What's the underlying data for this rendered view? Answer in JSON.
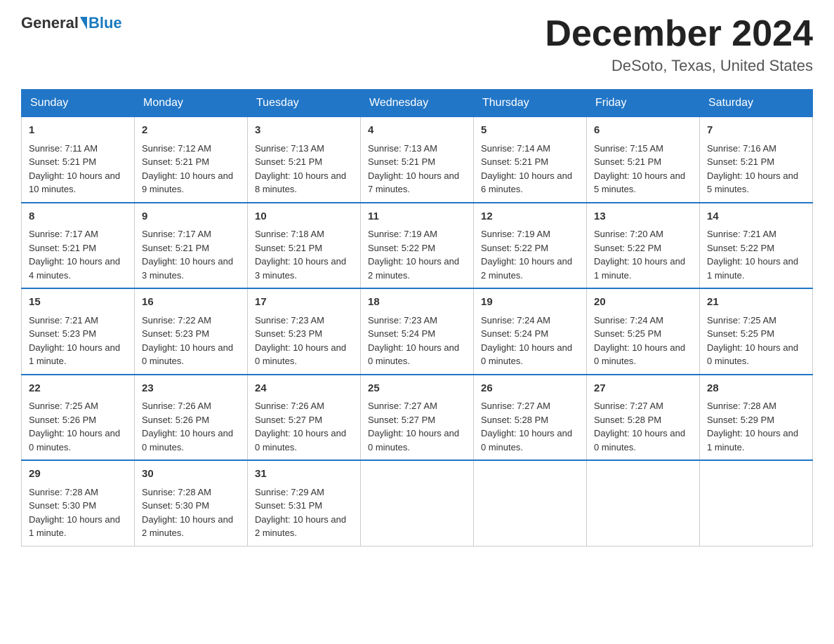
{
  "header": {
    "logo_general": "General",
    "logo_blue": "Blue",
    "month_title": "December 2024",
    "location": "DeSoto, Texas, United States"
  },
  "days_of_week": [
    "Sunday",
    "Monday",
    "Tuesday",
    "Wednesday",
    "Thursday",
    "Friday",
    "Saturday"
  ],
  "weeks": [
    [
      {
        "day": "1",
        "sunrise": "7:11 AM",
        "sunset": "5:21 PM",
        "daylight": "10 hours and 10 minutes."
      },
      {
        "day": "2",
        "sunrise": "7:12 AM",
        "sunset": "5:21 PM",
        "daylight": "10 hours and 9 minutes."
      },
      {
        "day": "3",
        "sunrise": "7:13 AM",
        "sunset": "5:21 PM",
        "daylight": "10 hours and 8 minutes."
      },
      {
        "day": "4",
        "sunrise": "7:13 AM",
        "sunset": "5:21 PM",
        "daylight": "10 hours and 7 minutes."
      },
      {
        "day": "5",
        "sunrise": "7:14 AM",
        "sunset": "5:21 PM",
        "daylight": "10 hours and 6 minutes."
      },
      {
        "day": "6",
        "sunrise": "7:15 AM",
        "sunset": "5:21 PM",
        "daylight": "10 hours and 5 minutes."
      },
      {
        "day": "7",
        "sunrise": "7:16 AM",
        "sunset": "5:21 PM",
        "daylight": "10 hours and 5 minutes."
      }
    ],
    [
      {
        "day": "8",
        "sunrise": "7:17 AM",
        "sunset": "5:21 PM",
        "daylight": "10 hours and 4 minutes."
      },
      {
        "day": "9",
        "sunrise": "7:17 AM",
        "sunset": "5:21 PM",
        "daylight": "10 hours and 3 minutes."
      },
      {
        "day": "10",
        "sunrise": "7:18 AM",
        "sunset": "5:21 PM",
        "daylight": "10 hours and 3 minutes."
      },
      {
        "day": "11",
        "sunrise": "7:19 AM",
        "sunset": "5:22 PM",
        "daylight": "10 hours and 2 minutes."
      },
      {
        "day": "12",
        "sunrise": "7:19 AM",
        "sunset": "5:22 PM",
        "daylight": "10 hours and 2 minutes."
      },
      {
        "day": "13",
        "sunrise": "7:20 AM",
        "sunset": "5:22 PM",
        "daylight": "10 hours and 1 minute."
      },
      {
        "day": "14",
        "sunrise": "7:21 AM",
        "sunset": "5:22 PM",
        "daylight": "10 hours and 1 minute."
      }
    ],
    [
      {
        "day": "15",
        "sunrise": "7:21 AM",
        "sunset": "5:23 PM",
        "daylight": "10 hours and 1 minute."
      },
      {
        "day": "16",
        "sunrise": "7:22 AM",
        "sunset": "5:23 PM",
        "daylight": "10 hours and 0 minutes."
      },
      {
        "day": "17",
        "sunrise": "7:23 AM",
        "sunset": "5:23 PM",
        "daylight": "10 hours and 0 minutes."
      },
      {
        "day": "18",
        "sunrise": "7:23 AM",
        "sunset": "5:24 PM",
        "daylight": "10 hours and 0 minutes."
      },
      {
        "day": "19",
        "sunrise": "7:24 AM",
        "sunset": "5:24 PM",
        "daylight": "10 hours and 0 minutes."
      },
      {
        "day": "20",
        "sunrise": "7:24 AM",
        "sunset": "5:25 PM",
        "daylight": "10 hours and 0 minutes."
      },
      {
        "day": "21",
        "sunrise": "7:25 AM",
        "sunset": "5:25 PM",
        "daylight": "10 hours and 0 minutes."
      }
    ],
    [
      {
        "day": "22",
        "sunrise": "7:25 AM",
        "sunset": "5:26 PM",
        "daylight": "10 hours and 0 minutes."
      },
      {
        "day": "23",
        "sunrise": "7:26 AM",
        "sunset": "5:26 PM",
        "daylight": "10 hours and 0 minutes."
      },
      {
        "day": "24",
        "sunrise": "7:26 AM",
        "sunset": "5:27 PM",
        "daylight": "10 hours and 0 minutes."
      },
      {
        "day": "25",
        "sunrise": "7:27 AM",
        "sunset": "5:27 PM",
        "daylight": "10 hours and 0 minutes."
      },
      {
        "day": "26",
        "sunrise": "7:27 AM",
        "sunset": "5:28 PM",
        "daylight": "10 hours and 0 minutes."
      },
      {
        "day": "27",
        "sunrise": "7:27 AM",
        "sunset": "5:28 PM",
        "daylight": "10 hours and 0 minutes."
      },
      {
        "day": "28",
        "sunrise": "7:28 AM",
        "sunset": "5:29 PM",
        "daylight": "10 hours and 1 minute."
      }
    ],
    [
      {
        "day": "29",
        "sunrise": "7:28 AM",
        "sunset": "5:30 PM",
        "daylight": "10 hours and 1 minute."
      },
      {
        "day": "30",
        "sunrise": "7:28 AM",
        "sunset": "5:30 PM",
        "daylight": "10 hours and 2 minutes."
      },
      {
        "day": "31",
        "sunrise": "7:29 AM",
        "sunset": "5:31 PM",
        "daylight": "10 hours and 2 minutes."
      },
      null,
      null,
      null,
      null
    ]
  ],
  "labels": {
    "sunrise": "Sunrise:",
    "sunset": "Sunset:",
    "daylight": "Daylight:"
  }
}
